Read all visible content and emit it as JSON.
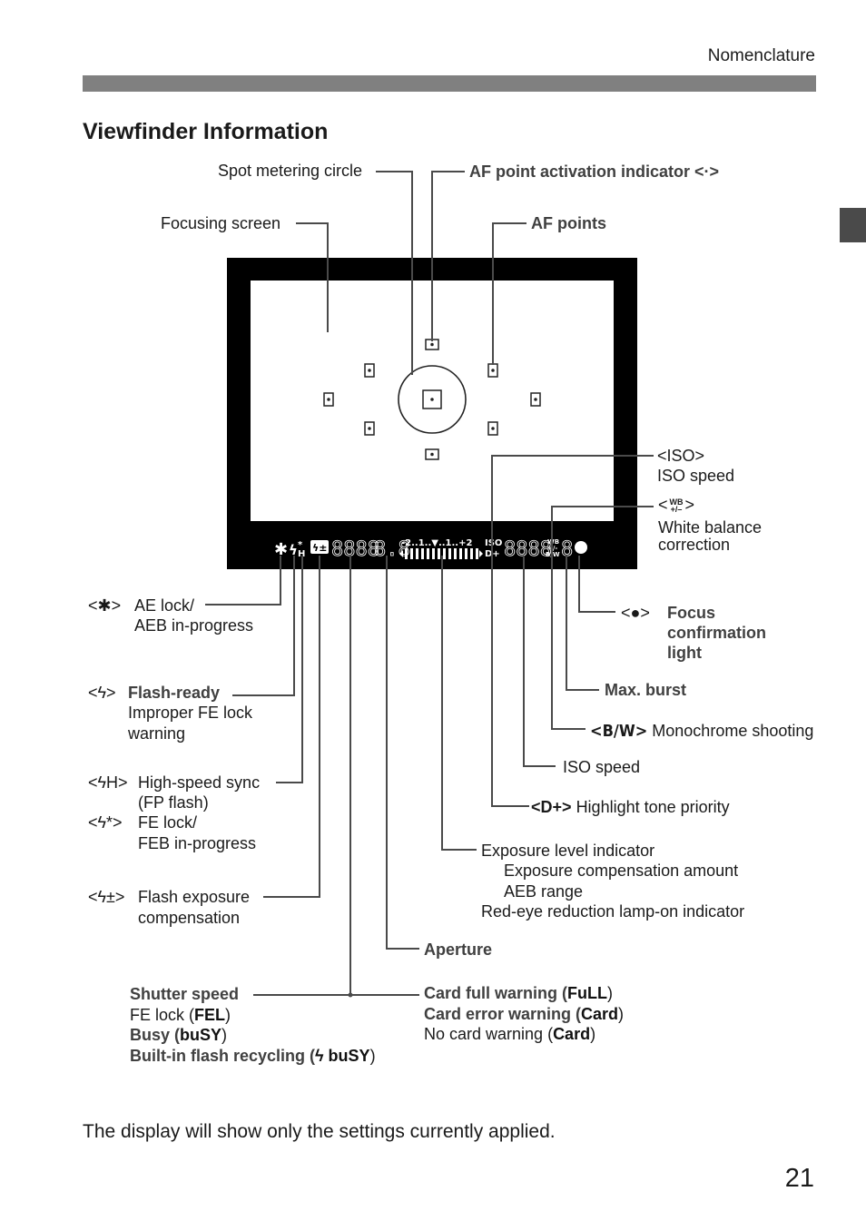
{
  "header": {
    "section": "Nomenclature"
  },
  "page_title": "Viewfinder Information",
  "top_labels": {
    "spot_metering_circle": "Spot metering circle",
    "af_point_activation": "AF point activation indicator <·>",
    "focusing_screen": "Focusing screen",
    "af_points": "AF points"
  },
  "viewfinder_display": {
    "ae_lock_symbol": "✱",
    "flash_symbol": "ϟ",
    "hs_symbol": "H",
    "fec_symbol": "ϟ±",
    "shutter_digits": "8888",
    "aperture_digits": "8.8",
    "scale_text": "-2..1..▼..1..+2",
    "iso_label": "ISO",
    "d_plus_label": "D+",
    "iso_digits": "8888",
    "wb_label": "WB",
    "wb_pm": "+/-",
    "bw_label": "B/W",
    "burst_digit": "8"
  },
  "right_labels": {
    "iso": {
      "symbol": "<ISO>",
      "text": "ISO speed"
    },
    "wb": {
      "symbol_prefix": "<",
      "symbol_top": "WB",
      "symbol_bottom": "+/–",
      "symbol_suffix": ">",
      "line1": "White balance",
      "line2": "correction"
    },
    "focus": {
      "symbol": "<●>",
      "line1": "Focus",
      "line2": "confirmation",
      "line3": "light"
    },
    "max_burst": "Max. burst",
    "monochrome": {
      "symbol": "<B/W>",
      "text": "Monochrome shooting"
    },
    "iso_speed": "ISO speed",
    "highlight": {
      "symbol": "<D+>",
      "text": "Highlight tone priority"
    },
    "exposure": {
      "line1": "Exposure level indicator",
      "line2": "Exposure compensation amount",
      "line3": "AEB range",
      "line4": "Red-eye reduction lamp-on indicator"
    },
    "aperture": "Aperture",
    "card": {
      "full": "Card full warning (",
      "full_code": "FuLL",
      "error": "Card error warning (",
      "error_code": "Card",
      "none": "No card warning (",
      "none_code": "Card",
      "close": ")"
    }
  },
  "left_labels": {
    "ae_lock": {
      "symbol": "<✱>",
      "line1": "AE lock/",
      "line2": "AEB in-progress"
    },
    "flash_ready": {
      "symbol": "<ϟ>",
      "title": "Flash-ready",
      "line2": "Improper FE lock",
      "line3": "warning"
    },
    "high_speed": {
      "symbol": "<ϟH>",
      "line1": "High-speed sync",
      "line2": "(FP flash)"
    },
    "fe_lock": {
      "symbol": "<ϟ*>",
      "line1": "FE lock/",
      "line2": "FEB in-progress"
    },
    "flash_comp": {
      "symbol": "<ϟ±>",
      "line1": "Flash exposure",
      "line2": "compensation"
    },
    "shutter": {
      "title": "Shutter speed",
      "fe_lock": "FE lock (",
      "fe_lock_code": "FEL",
      "busy": "Busy (",
      "busy_code": "buSY",
      "recycling": "Built-in flash recycling (",
      "recycling_code": "ϟ buSY",
      "close": ")"
    }
  },
  "footer": {
    "note": "The display will show only the settings currently applied.",
    "page_number": "21"
  }
}
